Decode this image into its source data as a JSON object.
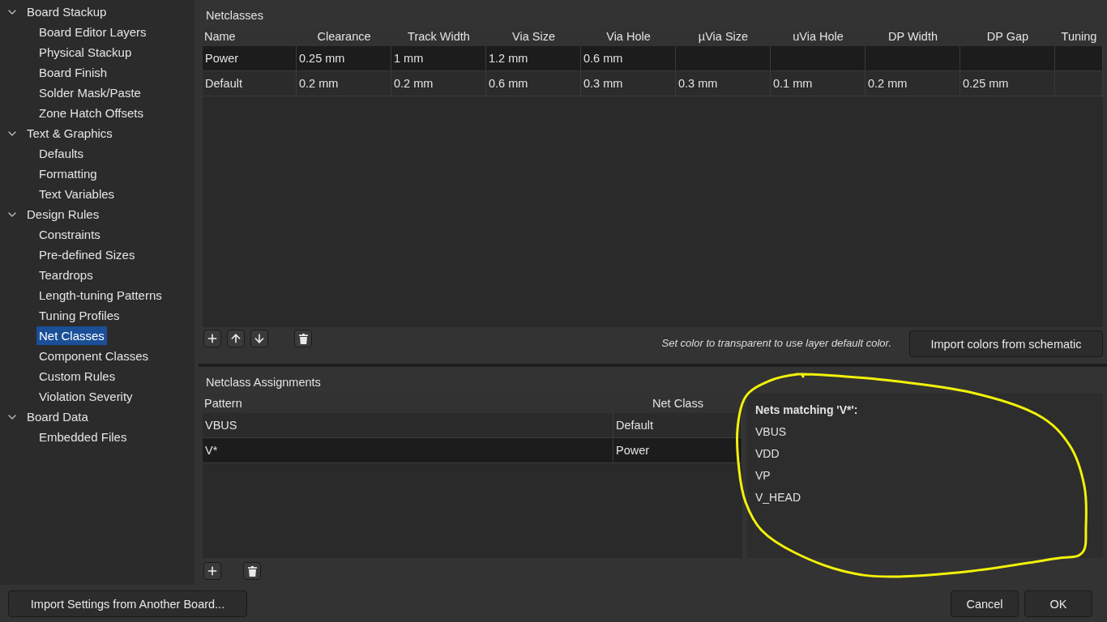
{
  "sidebar": {
    "items": [
      {
        "label": "Board Stackup",
        "expanded": true,
        "selected": false,
        "children": [
          {
            "label": "Board Editor Layers",
            "selected": false
          },
          {
            "label": "Physical Stackup",
            "selected": false
          },
          {
            "label": "Board Finish",
            "selected": false
          },
          {
            "label": "Solder Mask/Paste",
            "selected": false
          },
          {
            "label": "Zone Hatch Offsets",
            "selected": false
          }
        ]
      },
      {
        "label": "Text & Graphics",
        "expanded": true,
        "selected": false,
        "children": [
          {
            "label": "Defaults",
            "selected": false
          },
          {
            "label": "Formatting",
            "selected": false
          },
          {
            "label": "Text Variables",
            "selected": false
          }
        ]
      },
      {
        "label": "Design Rules",
        "expanded": true,
        "selected": false,
        "children": [
          {
            "label": "Constraints",
            "selected": false
          },
          {
            "label": "Pre-defined Sizes",
            "selected": false
          },
          {
            "label": "Teardrops",
            "selected": false
          },
          {
            "label": "Length-tuning Patterns",
            "selected": false
          },
          {
            "label": "Tuning Profiles",
            "selected": false
          },
          {
            "label": "Net Classes",
            "selected": true
          },
          {
            "label": "Component Classes",
            "selected": false
          },
          {
            "label": "Custom Rules",
            "selected": false
          },
          {
            "label": "Violation Severity",
            "selected": false
          }
        ]
      },
      {
        "label": "Board Data",
        "expanded": true,
        "selected": false,
        "children": [
          {
            "label": "Embedded Files",
            "selected": false
          }
        ]
      }
    ]
  },
  "netclasses": {
    "title": "Netclasses",
    "columns": [
      "Name",
      "Clearance",
      "Track Width",
      "Via Size",
      "Via Hole",
      "µVia Size",
      "uVia Hole",
      "DP Width",
      "DP Gap",
      "Tuning"
    ],
    "rows": [
      {
        "cells": [
          "Power",
          "0.25 mm",
          "1 mm",
          "1.2 mm",
          "0.6 mm"
        ],
        "selected": true
      },
      {
        "cells": [
          "Default",
          "0.2 mm",
          "0.2 mm",
          "0.6 mm",
          "0.3 mm",
          "0.3 mm",
          "0.1 mm",
          "0.2 mm",
          "0.25 mm"
        ],
        "selected": false
      }
    ],
    "hint": "Set color to transparent to use layer default color.",
    "import_button": "Import colors from schematic"
  },
  "assignments": {
    "title": "Netclass Assignments",
    "columns": [
      "Pattern",
      "Net Class"
    ],
    "rows": [
      {
        "cells": [
          "VBUS",
          "Default"
        ],
        "selected": false
      },
      {
        "cells": [
          "V*",
          "Power"
        ],
        "selected": true
      }
    ]
  },
  "matches": {
    "heading": "Nets matching 'V*':",
    "nets": [
      "VBUS",
      "VDD",
      "VP",
      "V_HEAD"
    ]
  },
  "footer": {
    "import_button": "Import Settings from Another Board...",
    "buttons": [
      "Cancel",
      "OK"
    ]
  }
}
